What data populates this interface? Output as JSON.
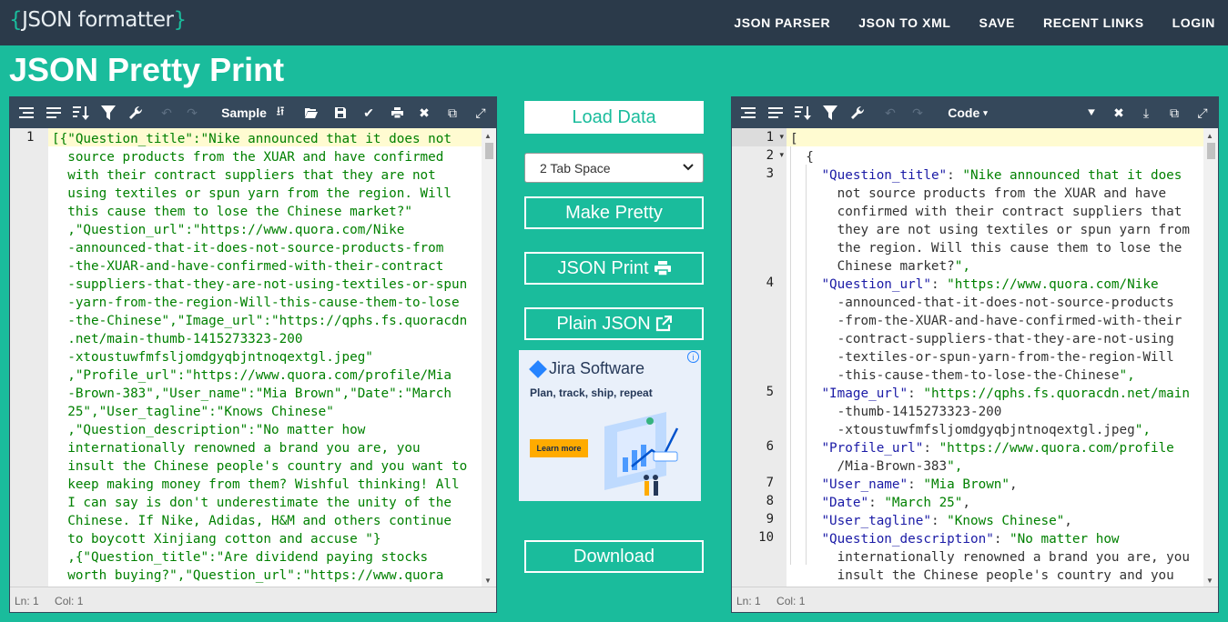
{
  "app": {
    "logo_open": "{",
    "logo_text": "JSON formatter",
    "logo_close": "}",
    "nav": [
      "JSON PARSER",
      "JSON TO XML",
      "SAVE",
      "RECENT LINKS",
      "LOGIN"
    ]
  },
  "page_title": "JSON Pretty Print",
  "left_editor": {
    "sample_label": "Sample",
    "line_number": "1",
    "status_ln": "Ln: 1",
    "status_col": "Col: 1",
    "lines": [
      "[{\"Question_title\":\"Nike announced that it does not",
      "  source products from the XUAR and have confirmed",
      "  with their contract suppliers that they are not",
      "  using textiles or spun yarn from the region. Will",
      "  this cause them to lose the Chinese market?\"",
      "  ,\"Question_url\":\"https://www.quora.com/Nike",
      "  -announced-that-it-does-not-source-products-from",
      "  -the-XUAR-and-have-confirmed-with-their-contract",
      "  -suppliers-that-they-are-not-using-textiles-or-spun",
      "  -yarn-from-the-region-Will-this-cause-them-to-lose",
      "  -the-Chinese\",\"Image_url\":\"https://qphs.fs.quoracdn",
      "  .net/main-thumb-1415273323-200",
      "  -xtoustuwfmfsljomdgyqbjntnoqextgl.jpeg\"",
      "  ,\"Profile_url\":\"https://www.quora.com/profile/Mia",
      "  -Brown-383\",\"User_name\":\"Mia Brown\",\"Date\":\"March",
      "  25\",\"User_tagline\":\"Knows Chinese\"",
      "  ,\"Question_description\":\"No matter how",
      "  internationally renowned a brand you are, you",
      "  insult the Chinese people's country and you want to",
      "  keep making money from them? Wishful thinking! All",
      "  I can say is don't underestimate the unity of the",
      "  Chinese. If Nike, Adidas, H&M and others continue",
      "  to boycott Xinjiang cotton and accuse \"}",
      "  ,{\"Question_title\":\"Are dividend paying stocks",
      "  worth buying?\",\"Question_url\":\"https://www.quora"
    ]
  },
  "middle": {
    "load_data": "Load Data",
    "tab_select": "2 Tab Space",
    "make_pretty": "Make Pretty",
    "json_print": "JSON Print",
    "plain_json": "Plain JSON",
    "download": "Download",
    "ad": {
      "brand": "Jira Software",
      "tagline": "Plan, track, ship, repeat",
      "cta": "Learn more",
      "info": "i"
    }
  },
  "right_editor": {
    "mode_label": "Code",
    "status_ln": "Ln: 1",
    "status_col": "Col: 1",
    "line_numbers": [
      "1",
      "2",
      "3",
      "4",
      "5",
      "6",
      "7",
      "8",
      "9",
      "10"
    ],
    "lines": [
      {
        "n": "1",
        "fold": true,
        "text": "["
      },
      {
        "n": "2",
        "fold": true,
        "text": "  {"
      },
      {
        "n": "3",
        "text": "    \"Question_title\": \"Nike announced that it does"
      },
      {
        "n": "",
        "text": "      not source products from the XUAR and have"
      },
      {
        "n": "",
        "text": "      confirmed with their contract suppliers that"
      },
      {
        "n": "",
        "text": "      they are not using textiles or spun yarn from"
      },
      {
        "n": "",
        "text": "      the region. Will this cause them to lose the"
      },
      {
        "n": "",
        "text": "      Chinese market?\","
      },
      {
        "n": "4",
        "text": "    \"Question_url\": \"https://www.quora.com/Nike"
      },
      {
        "n": "",
        "text": "      -announced-that-it-does-not-source-products"
      },
      {
        "n": "",
        "text": "      -from-the-XUAR-and-have-confirmed-with-their"
      },
      {
        "n": "",
        "text": "      -contract-suppliers-that-they-are-not-using"
      },
      {
        "n": "",
        "text": "      -textiles-or-spun-yarn-from-the-region-Will"
      },
      {
        "n": "",
        "text": "      -this-cause-them-to-lose-the-Chinese\","
      },
      {
        "n": "5",
        "text": "    \"Image_url\": \"https://qphs.fs.quoracdn.net/main"
      },
      {
        "n": "",
        "text": "      -thumb-1415273323-200"
      },
      {
        "n": "",
        "text": "      -xtoustuwfmfsljomdgyqbjntnoqextgl.jpeg\","
      },
      {
        "n": "6",
        "text": "    \"Profile_url\": \"https://www.quora.com/profile"
      },
      {
        "n": "",
        "text": "      /Mia-Brown-383\","
      },
      {
        "n": "7",
        "text": "    \"User_name\": \"Mia Brown\","
      },
      {
        "n": "8",
        "text": "    \"Date\": \"March 25\","
      },
      {
        "n": "9",
        "text": "    \"User_tagline\": \"Knows Chinese\","
      },
      {
        "n": "10",
        "text": "    \"Question_description\": \"No matter how"
      },
      {
        "n": "",
        "text": "      internationally renowned a brand you are, you"
      },
      {
        "n": "",
        "text": "      insult the Chinese people's country and you"
      }
    ]
  },
  "colors": {
    "accent": "#1abc9c",
    "topbar": "#2b3a4a",
    "toolbar": "#35485b",
    "string": "#008000",
    "key": "#1a1aa6"
  }
}
